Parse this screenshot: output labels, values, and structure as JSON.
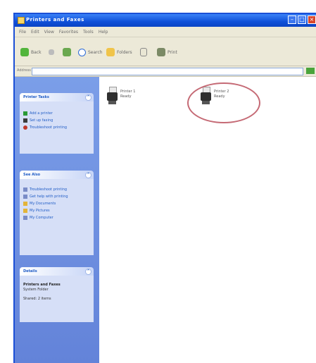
{
  "window": {
    "title": "Printers and Faxes",
    "controls": {
      "minimize": "–",
      "maximize": "□",
      "close": "×"
    }
  },
  "menubar": [
    "File",
    "Edit",
    "View",
    "Favorites",
    "Tools",
    "Help"
  ],
  "toolbar": {
    "back": "Back",
    "search": "Search",
    "folders": "Folders",
    "views": "",
    "print": "Print"
  },
  "address": {
    "label": "Address",
    "value": ""
  },
  "taskpane": {
    "printer_tasks": {
      "title": "Printer Tasks",
      "items": [
        {
          "label": "Add a printer",
          "icon": "add-printer-icon"
        },
        {
          "label": "Set up faxing",
          "icon": "fax-icon"
        },
        {
          "label": "Troubleshoot printing",
          "icon": "troubleshoot-icon"
        }
      ]
    },
    "see_also": {
      "title": "See Also",
      "items": [
        {
          "label": "Troubleshoot printing",
          "icon": "help-icon"
        },
        {
          "label": "Get help with printing",
          "icon": "help-icon"
        },
        {
          "label": "My Documents",
          "icon": "folder-icon"
        },
        {
          "label": "My Pictures",
          "icon": "folder-icon"
        },
        {
          "label": "My Computer",
          "icon": "computer-icon"
        }
      ]
    },
    "details": {
      "title": "Details",
      "name": "Printers and Faxes",
      "type": "System Folder",
      "info": "Shared: 2 items"
    }
  },
  "printers": [
    {
      "name": "Printer 1",
      "status": "Ready"
    },
    {
      "name": "Printer 2",
      "status": "Ready"
    }
  ],
  "colors": {
    "title_bar": "#0f50d8",
    "task_pane": "#6b8ee0",
    "highlight_ring": "#c56a75"
  }
}
